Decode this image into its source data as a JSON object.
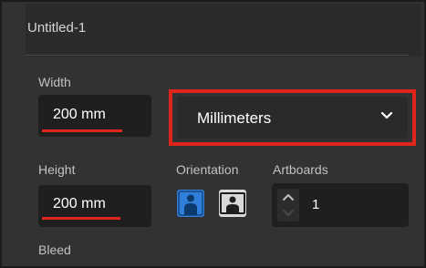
{
  "document": {
    "title": "Untitled-1"
  },
  "width": {
    "label": "Width",
    "value": "200 mm"
  },
  "units": {
    "selected": "Millimeters"
  },
  "height": {
    "label": "Height",
    "value": "200 mm"
  },
  "orientation": {
    "label": "Orientation",
    "options": [
      {
        "icon": "portrait-person-icon",
        "selected": true
      },
      {
        "icon": "landscape-person-icon",
        "selected": false
      }
    ]
  },
  "artboards": {
    "label": "Artboards",
    "value": "1"
  },
  "bleed": {
    "label": "Bleed"
  },
  "colors": {
    "highlight": "#e0261c",
    "accent": "#2f7fd8",
    "panel_bg": "#323232"
  }
}
